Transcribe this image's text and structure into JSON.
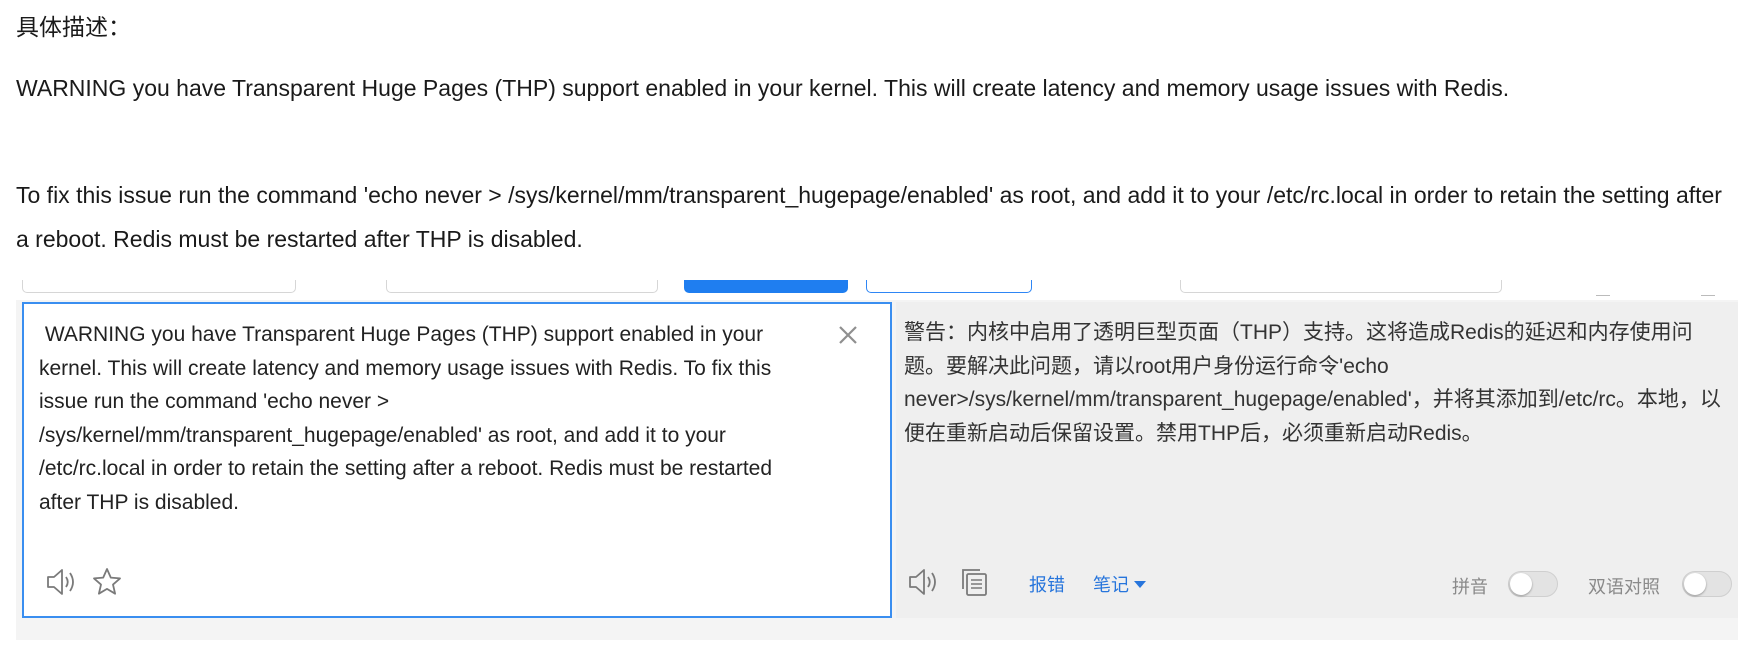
{
  "document": {
    "label": "具体描述：",
    "paragraph1": "WARNING you have Transparent Huge Pages (THP) support enabled in your kernel. This will create latency and memory usage issues with Redis.",
    "paragraph2": "To fix this issue run the command 'echo never > /sys/kernel/mm/transparent_hugepage/enabled' as root, and add it to your /etc/rc.local in order to retain the setting after a reboot. Redis must be restarted after THP is disabled."
  },
  "translator": {
    "source_text": " WARNING you have Transparent Huge Pages (THP) support enabled in your kernel. This will create latency and memory usage issues with Redis. To fix this issue run the command 'echo never > /sys/kernel/mm/transparent_hugepage/enabled' as root, and add it to your /etc/rc.local in order to retain the setting after a reboot. Redis must be restarted after THP is disabled.",
    "target_text": "警告：内核中启用了透明巨型页面（THP）支持。这将造成Redis的延迟和内存使用问题。要解决此问题，请以root用户身份运行命令'echo never>/sys/kernel/mm/transparent_hugepage/enabled'，并将其添加到/etc/rc。本地，以便在重新启动后保留设置。禁用THP后，必须重新启动Redis。",
    "report_error_label": "报错",
    "notes_label": "笔记",
    "pinyin_label": "拼音",
    "bilingual_label": "双语对照",
    "pinyin_enabled": false,
    "bilingual_enabled": false,
    "accent_color": "#1f7ef0",
    "icons": [
      "close-icon",
      "speaker-icon",
      "star-icon",
      "copy-icon",
      "caret-down-icon"
    ]
  }
}
